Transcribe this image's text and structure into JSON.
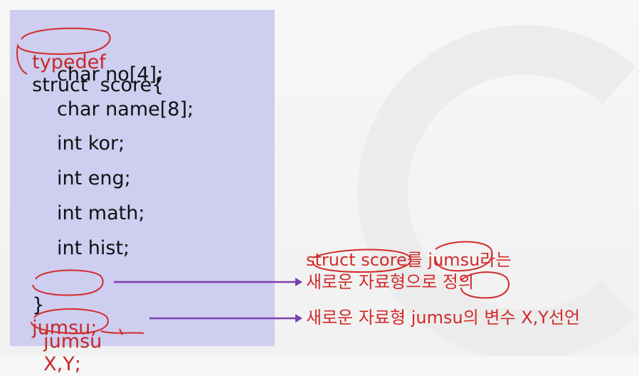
{
  "code": {
    "line1_keyword": "typedef",
    "line1_rest": "struct  score{",
    "line2": "char no[4];",
    "line3": "char name[8];",
    "line4": "int kor;",
    "line5": "int eng;",
    "line6": "int math;",
    "line7": "int hist;",
    "line8_brace": "}",
    "line8_name": "jumsu;",
    "line9_type": "jumsu",
    "line9_vars": "X,Y;"
  },
  "annotations": {
    "note1_line1": "struct score를 jumsu라는",
    "note1_line2": "새로운 자료형으로 정의",
    "note2": "새로운 자료형 jumsu의 변수 X,Y선언"
  },
  "colors": {
    "code_bg": "#cdcef0",
    "annotation_red": "#d22a2a",
    "arrow_purple": "#7b3fb0"
  }
}
